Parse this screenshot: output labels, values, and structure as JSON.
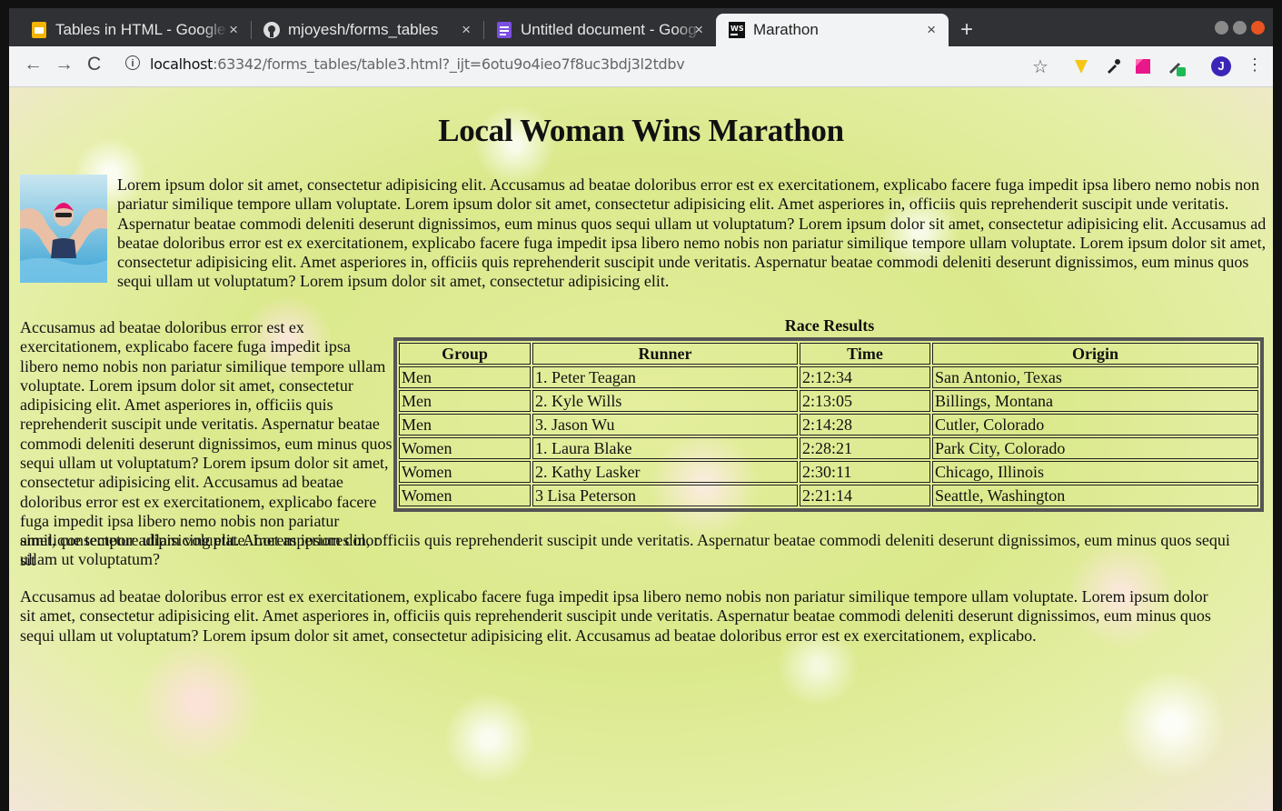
{
  "tabs": [
    {
      "title": "Tables in HTML - Google S",
      "icon": "google-slides-icon"
    },
    {
      "title": "mjoyesh/forms_tables",
      "icon": "github-icon"
    },
    {
      "title": "Untitled document - Goog",
      "icon": "google-docs-icon"
    },
    {
      "title": "Marathon",
      "icon": "webstorm-icon"
    }
  ],
  "address_bar": {
    "host": "localhost",
    "rest": ":63342/forms_tables/table3.html?_ijt=6otu9o4ieo7f8uc3bdj3l2tdbv"
  },
  "profile": {
    "initial": "J",
    "color": "#3b25b8"
  },
  "page": {
    "heading": "Local Woman Wins Marathon",
    "paragraph1": "Lorem ipsum dolor sit amet, consectetur adipisicing elit. Accusamus ad beatae doloribus error est ex exercitationem, explicabo facere fuga impedit ipsa libero nemo nobis non pariatur similique tempore ullam voluptate. Lorem ipsum dolor sit amet, consectetur adipisicing elit. Amet asperiores in, officiis quis reprehenderit suscipit unde veritatis. Aspernatur beatae commodi deleniti deserunt dignissimos, eum minus quos sequi ullam ut voluptatum? Lorem ipsum dolor sit amet, consectetur adipisicing elit. Accusamus ad beatae doloribus error est ex exercitationem, explicabo facere fuga impedit ipsa libero nemo nobis non pariatur similique tempore ullam voluptate. Lorem ipsum dolor sit amet, consectetur adipisicing elit. Amet asperiores in, officiis quis reprehenderit suscipit unde veritatis. Aspernatur beatae commodi deleniti deserunt dignissimos, eum minus quos sequi ullam ut voluptatum? Lorem ipsum dolor sit amet, consectetur adipisicing elit.",
    "paragraph2_side": "Accusamus ad beatae doloribus error est ex exercitationem, explicabo facere fuga impedit ipsa libero nemo nobis non pariatur similique tempore ullam voluptate. Lorem ipsum dolor sit amet, consectetur adipisicing elit. Amet asperiores in, officiis quis reprehenderit suscipit unde veritatis. Aspernatur beatae commodi deleniti deserunt dignissimos, eum minus quos sequi ullam ut voluptatum? Lorem ipsum dolor sit amet, consectetur adipisicing elit. Accusamus ad beatae doloribus error est ex exercitationem, explicabo facere fuga impedit ipsa libero nemo nobis non pariatur similique tempore ullam voluptate. Lorem ipsum dolor sit",
    "paragraph2_cont": "amet, consectetur adipisicing elit. Amet asperiores in, officiis quis reprehenderit suscipit unde veritatis. Aspernatur beatae commodi deleniti deserunt dignissimos, eum minus quos sequi ullam ut voluptatum?",
    "paragraph3": "Accusamus ad beatae doloribus error est ex exercitationem, explicabo facere fuga impedit ipsa libero nemo nobis non pariatur similique tempore ullam voluptate. Lorem ipsum dolor sit amet, consectetur adipisicing elit. Amet asperiores in, officiis quis reprehenderit suscipit unde veritatis. Aspernatur beatae commodi deleniti deserunt dignissimos, eum minus quos sequi ullam ut voluptatum? Lorem ipsum dolor sit amet, consectetur adipisicing elit. Accusamus ad beatae doloribus error est ex exercitationem, explicabo.",
    "table": {
      "caption": "Race Results",
      "headers": [
        "Group",
        "Runner",
        "Time",
        "Origin"
      ],
      "rows": [
        [
          "Men",
          "1. Peter Teagan",
          "2:12:34",
          "San Antonio, Texas"
        ],
        [
          "Men",
          "2. Kyle Wills",
          "2:13:05",
          "Billings, Montana"
        ],
        [
          "Men",
          "3. Jason Wu",
          "2:14:28",
          "Cutler, Colorado"
        ],
        [
          "Women",
          "1. Laura Blake",
          "2:28:21",
          "Park City, Colorado"
        ],
        [
          "Women",
          "2. Kathy Lasker",
          "2:30:11",
          "Chicago, Illinois"
        ],
        [
          "Women",
          "3 Lisa Peterson",
          "2:21:14",
          "Seattle, Washington"
        ]
      ]
    }
  }
}
